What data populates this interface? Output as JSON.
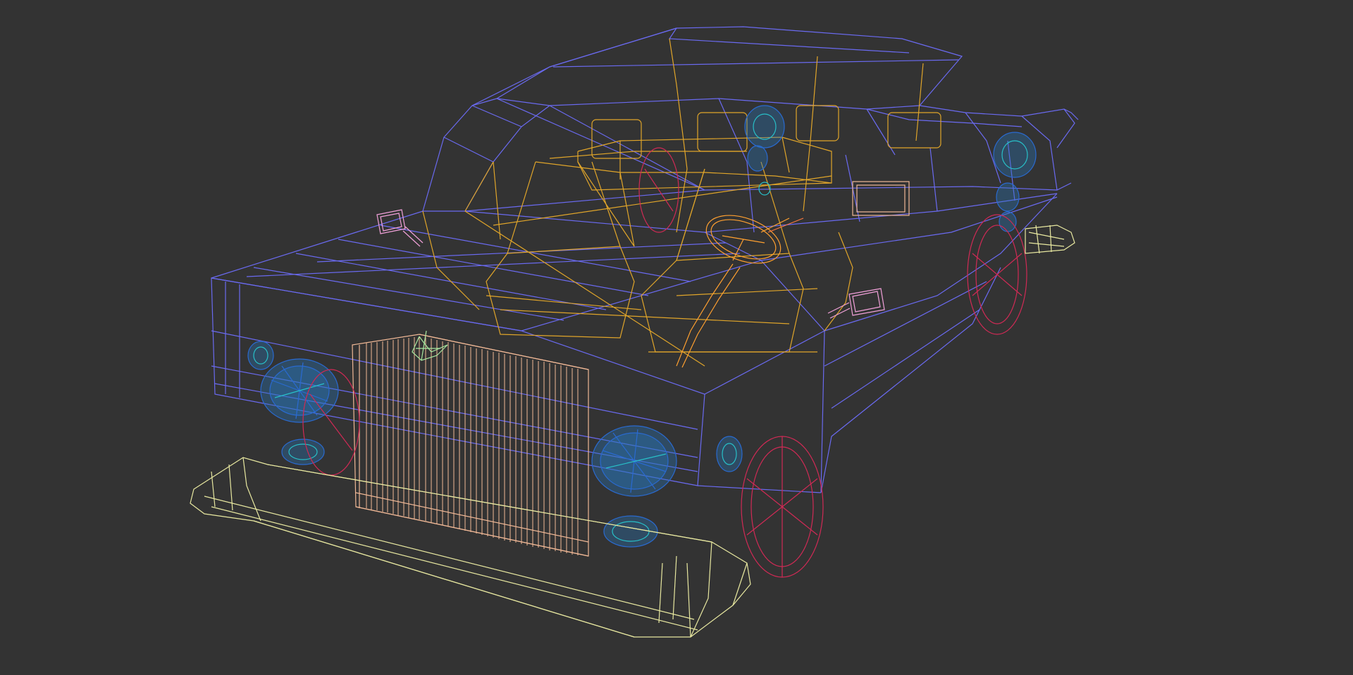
{
  "viewport": {
    "background": "#333333",
    "object": "car-wireframe-model",
    "render_mode": "wireframe"
  },
  "colors": {
    "body": "#6a6af0",
    "interior": "#e0a52a",
    "grille": "#f0b896",
    "bumpers": "#e8e8a0",
    "lights": "#2a6ad0",
    "light_inner": "#28c0c8",
    "tires": "#d02a55",
    "mirrors": "#f0a0d8",
    "hood_ornament": "#a8e8a0",
    "steering_wheel": "#ffa030"
  }
}
